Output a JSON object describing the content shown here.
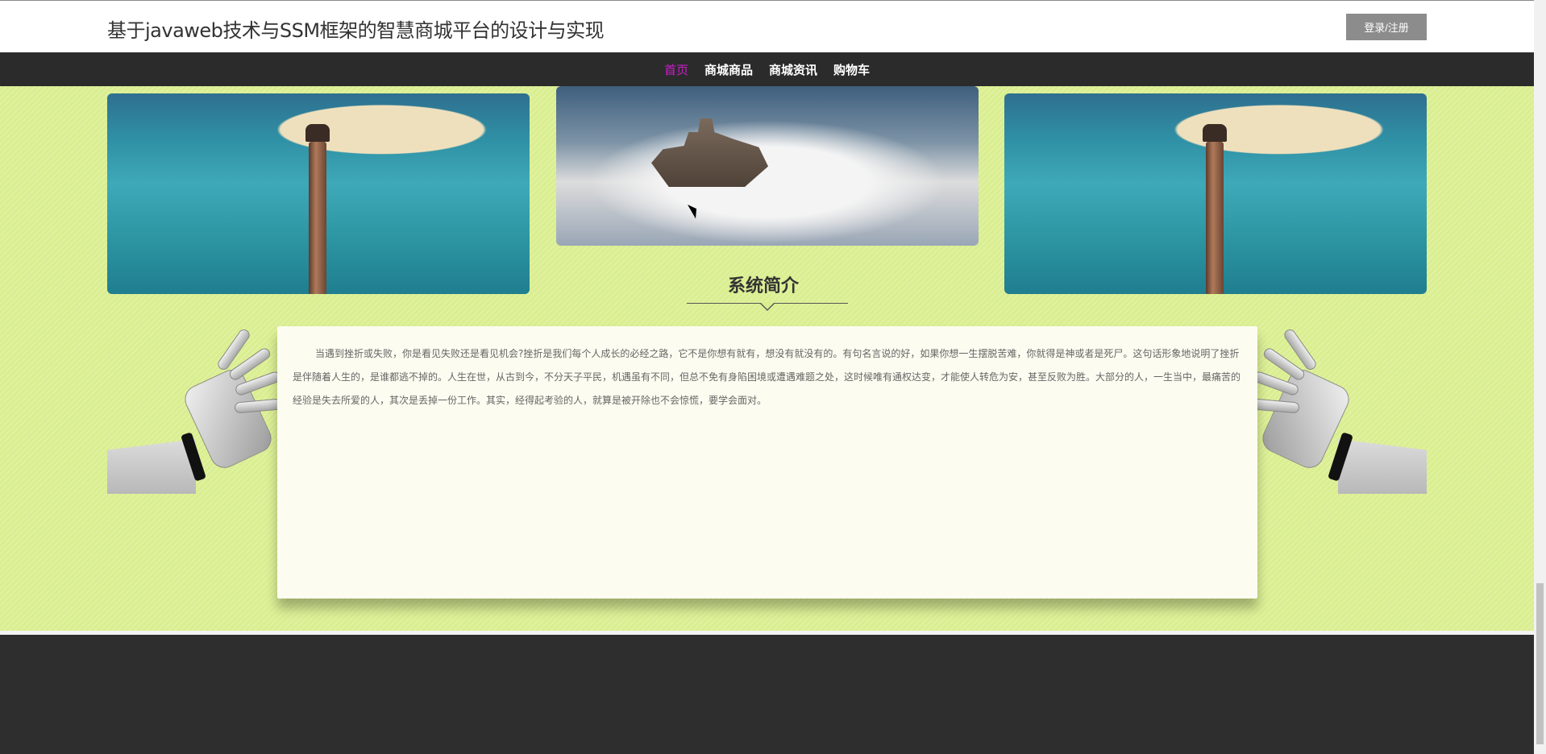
{
  "header": {
    "title": "基于javaweb技术与SSM框架的智慧商城平台的设计与实现",
    "login_label": "登录/注册"
  },
  "nav": {
    "items": [
      {
        "label": "首页",
        "active": true
      },
      {
        "label": "商城商品",
        "active": false
      },
      {
        "label": "商城资讯",
        "active": false
      },
      {
        "label": "购物车",
        "active": false
      }
    ]
  },
  "carousel": {
    "slides": [
      "lighthouse-image",
      "castle-in-clouds-image",
      "lighthouse-image"
    ]
  },
  "intro": {
    "title": "系统简介",
    "text": "当遇到挫折或失败，你是看见失败还是看见机会?挫折是我们每个人成长的必经之路，它不是你想有就有，想没有就没有的。有句名言说的好，如果你想一生摆脱苦难，你就得是神或者是死尸。这句话形象地说明了挫折是伴随着人生的，是谁都逃不掉的。人生在世，从古到今，不分天子平民，机遇虽有不同，但总不免有身陷困境或遭遇难题之处，这时候唯有通权达变，才能使人转危为安，甚至反败为胜。大部分的人，一生当中，最痛苦的经验是失去所爱的人，其次是丢掉一份工作。其实，经得起考验的人，就算是被开除也不会惊慌，要学会面对。"
  },
  "colors": {
    "accent": "#d11bd1",
    "nav_bg": "#2b2b2b",
    "main_bg": "#d9ee8e",
    "footer_bg": "#2e2e2e"
  }
}
